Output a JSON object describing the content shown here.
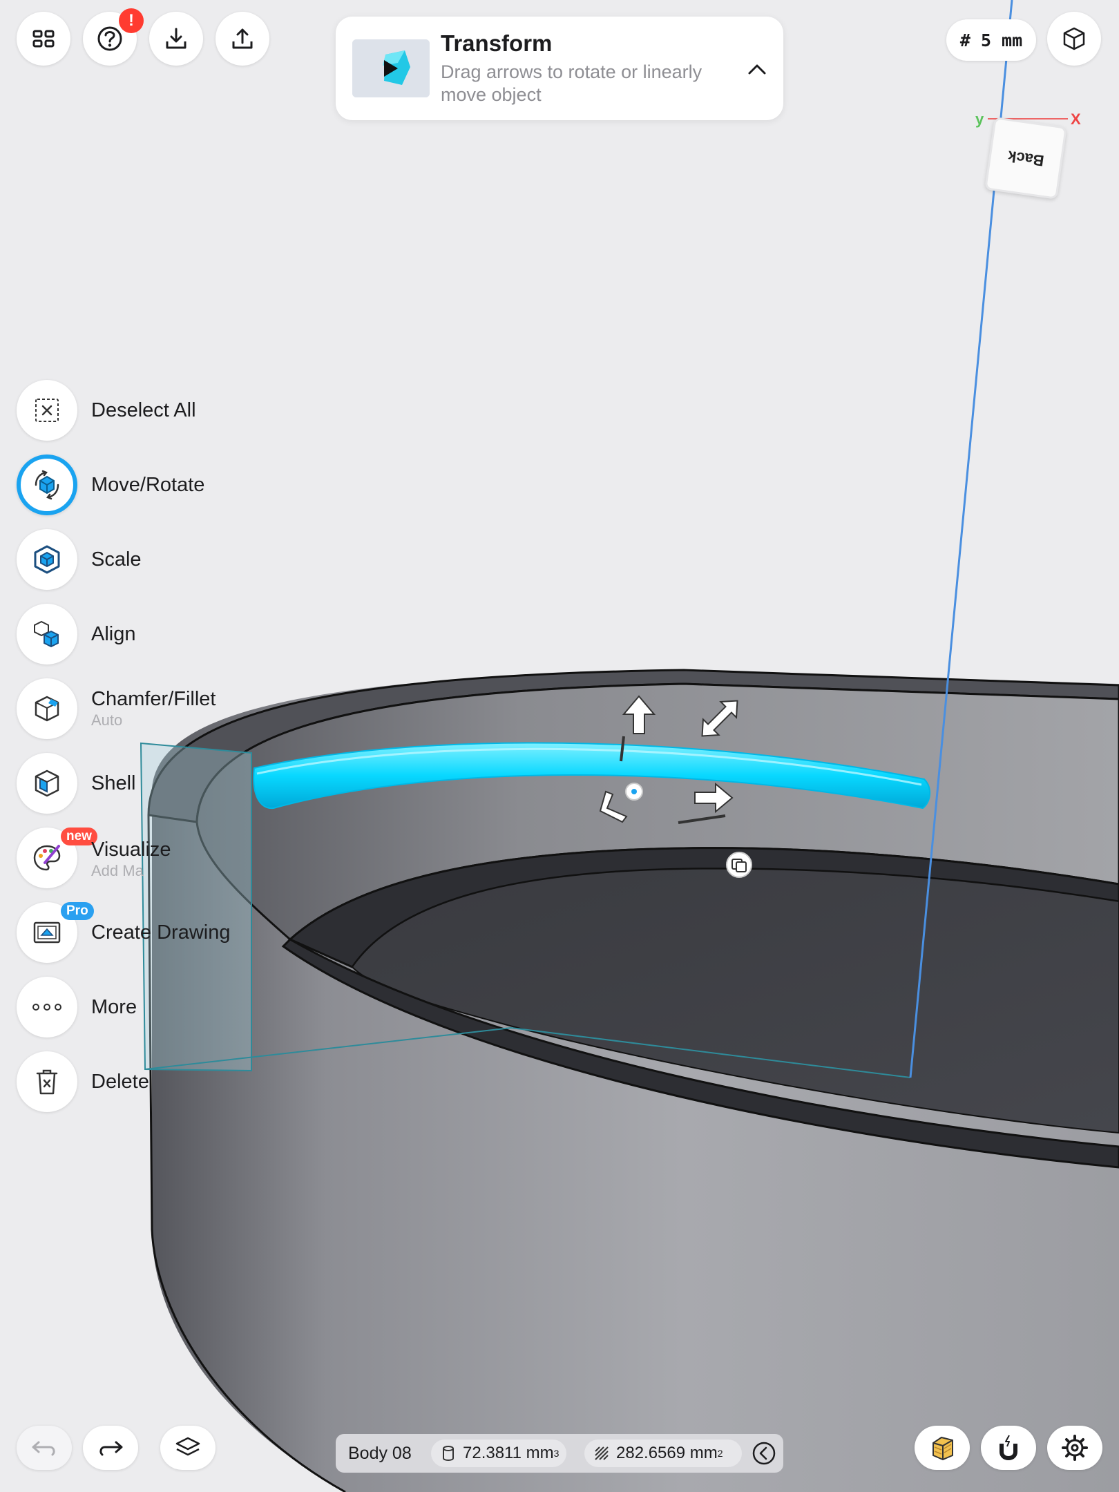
{
  "top_toolbar": {
    "help_badge": "!"
  },
  "transform_card": {
    "title": "Transform",
    "description": "Drag arrows to rotate or linearly move object"
  },
  "grid_size_label": "# 5 mm",
  "view_cube": {
    "face_label": "Back",
    "axis_x": "X",
    "axis_y": "y"
  },
  "side_menu": {
    "deselect_all": "Deselect All",
    "move_rotate": "Move/Rotate",
    "scale": "Scale",
    "align": "Align",
    "chamfer_fillet": "Chamfer/Fillet",
    "chamfer_fillet_sub": "Auto",
    "shell": "Shell",
    "visualize": "Visualize",
    "visualize_sub": "Add Ma",
    "visualize_tag": "new",
    "create_drawing": "Create Drawing",
    "create_drawing_tag": "Pro",
    "more": "More",
    "delete": "Delete"
  },
  "status_bar": {
    "body_name": "Body 08",
    "volume": "72.3811 mm",
    "volume_exp": "3",
    "area": "282.6569 mm",
    "area_exp": "2"
  },
  "colors": {
    "accent": "#1aa3f0",
    "selection": "#00d4ff",
    "alert": "#ff3b30",
    "pro": "#2aa0f0"
  }
}
